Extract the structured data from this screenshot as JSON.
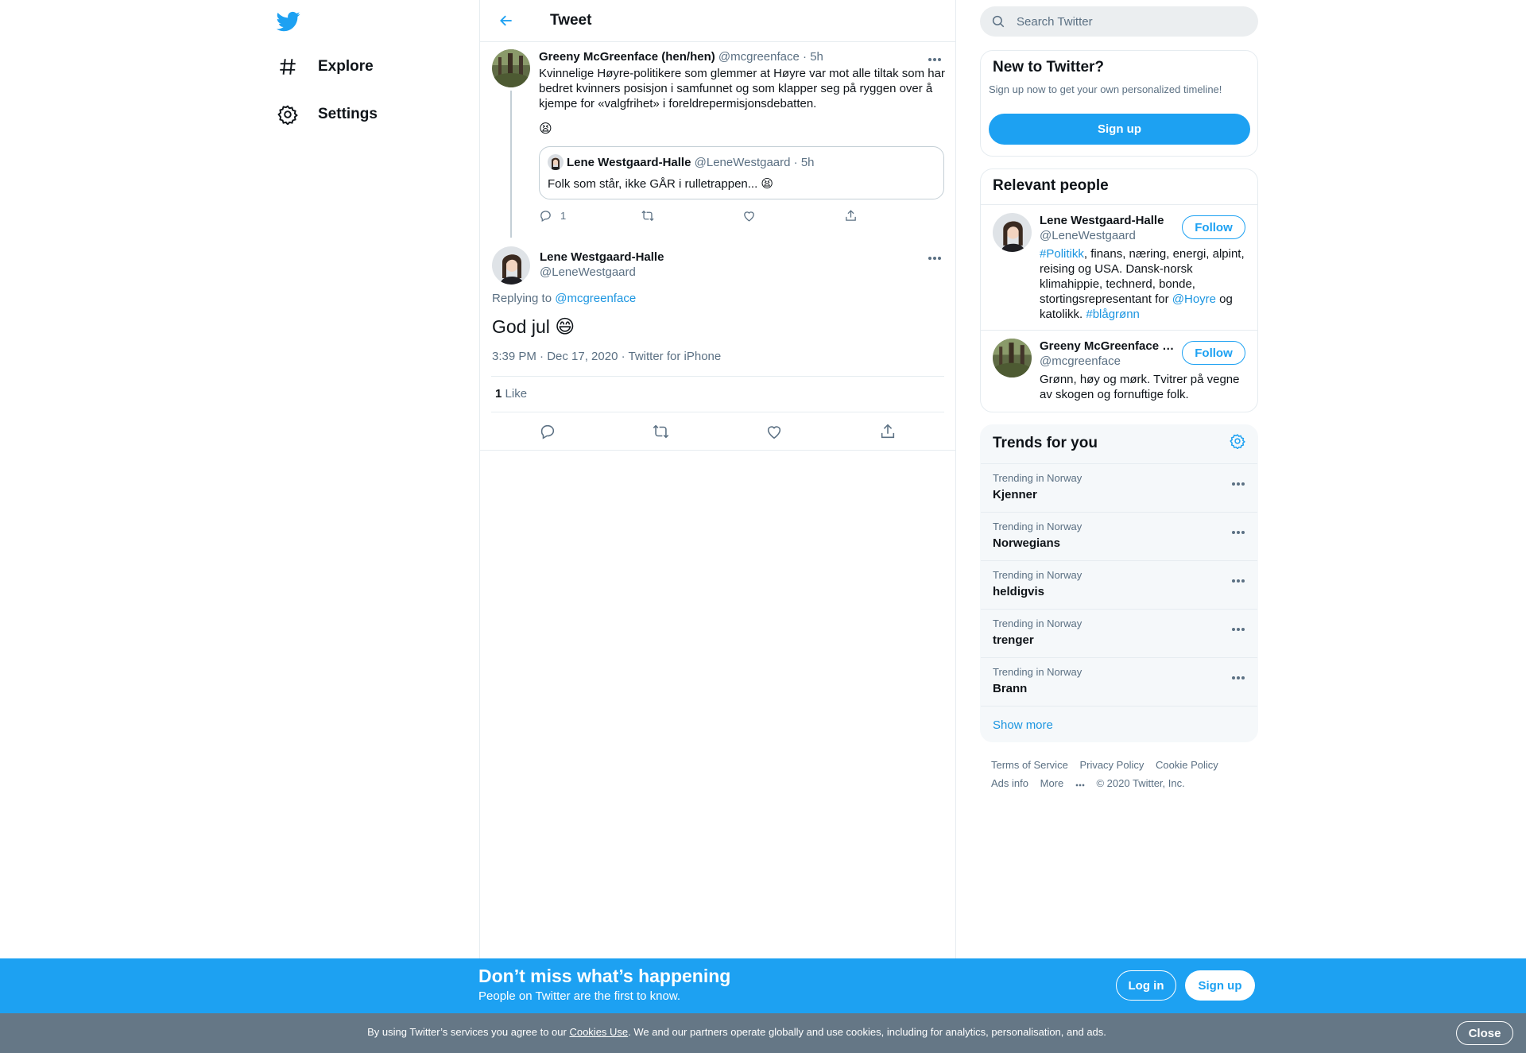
{
  "colors": {
    "brand": "#1da1f2",
    "link": "#1b95e0",
    "text": "#0f1419",
    "muted": "#5b7083",
    "cookie_bar": "#657786"
  },
  "nav": {
    "logo_icon": "twitter-bird-icon",
    "items": [
      {
        "label": "Explore",
        "icon": "hashtag-icon"
      },
      {
        "label": "Settings",
        "icon": "gear-icon"
      }
    ]
  },
  "header": {
    "title": "Tweet",
    "back_icon": "arrow-left-icon"
  },
  "parent_tweet": {
    "name": "Greeny McGreenface (hen/hen)",
    "handle": "@mcgreenface",
    "time": "· 5h",
    "text": "Kvinnelige Høyre-politikere som glemmer at Høyre var mot alle tiltak som har bedret kvinners posisjon i samfunnet og som klapper seg på ryggen over å kjempe for «valgfrihet» i foreldrepermisjonsdebatten.",
    "emoji": "😫",
    "quote": {
      "name": "Lene Westgaard-Halle",
      "handle": "@LeneWestgaard",
      "time": "· 5h",
      "text": "Folk som står, ikke GÅR i rulletrappen... 😫"
    },
    "reply_count": "1"
  },
  "focus_tweet": {
    "name": "Lene Westgaard-Halle",
    "handle": "@LeneWestgaard",
    "replying_prefix": "Replying to",
    "replying_to": "@mcgreenface",
    "text": "God jul",
    "emoji": "😄",
    "time": "3:39 PM · Dec 17, 2020",
    "source": "Twitter for iPhone",
    "likes_count": "1",
    "likes_label": "Like"
  },
  "search": {
    "placeholder": "Search Twitter"
  },
  "new_to_twitter": {
    "title": "New to Twitter?",
    "subtitle": "Sign up now to get your own personalized timeline!",
    "button": "Sign up"
  },
  "relevant_people": {
    "title": "Relevant people",
    "follow_label": "Follow",
    "people": [
      {
        "name": "Lene Westgaard-Halle",
        "handle": "@LeneWestgaard",
        "bio_parts": [
          "#Politikk",
          ", finans, næring, energi, alpint, reising og USA. Dansk-norsk klimahippie, technerd, bonde, stortingsrepresentant for ",
          "@Hoyre",
          " og katolikk. ",
          "#blågrønn"
        ]
      },
      {
        "name": "Greeny McGreenface (hen/hen)",
        "handle": "@mcgreenface",
        "bio": "Grønn, høy og mørk. Tvitrer på vegne av skogen og fornuftige folk."
      }
    ]
  },
  "trends": {
    "title": "Trends for you",
    "items": [
      {
        "category": "Trending in Norway",
        "name": "Kjenner"
      },
      {
        "category": "Trending in Norway",
        "name": "Norwegians"
      },
      {
        "category": "Trending in Norway",
        "name": "heldigvis"
      },
      {
        "category": "Trending in Norway",
        "name": "trenger"
      },
      {
        "category": "Trending in Norway",
        "name": "Brann"
      }
    ],
    "show_more": "Show more"
  },
  "footer": {
    "links": [
      "Terms of Service",
      "Privacy Policy",
      "Cookie Policy",
      "Ads info",
      "More"
    ],
    "copyright": "© 2020 Twitter, Inc."
  },
  "banner": {
    "title": "Don’t miss what’s happening",
    "subtitle": "People on Twitter are the first to know.",
    "login": "Log in",
    "signup": "Sign up"
  },
  "cookie": {
    "prefix": "By using Twitter’s services you agree to our ",
    "link": "Cookies Use",
    "suffix": ". We and our partners operate globally and use cookies, including for analytics, personalisation, and ads.",
    "close": "Close"
  }
}
